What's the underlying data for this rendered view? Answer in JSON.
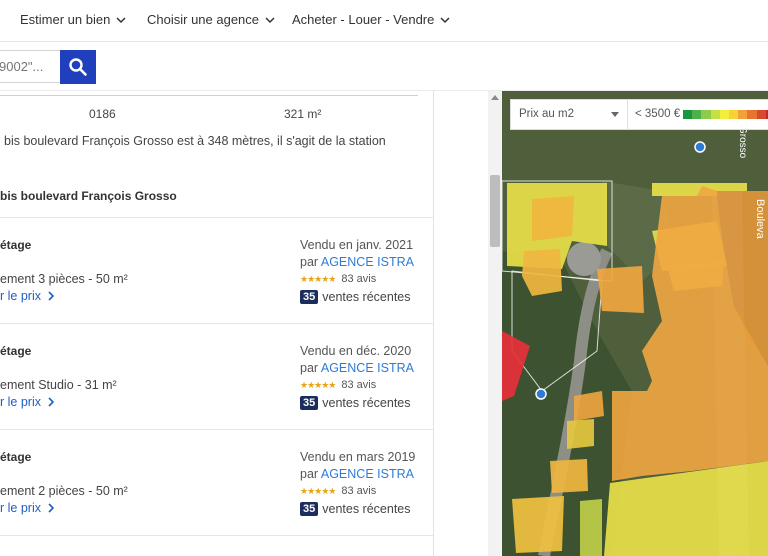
{
  "nav": {
    "items": [
      {
        "label": "Estimer un bien"
      },
      {
        "label": "Choisir une agence"
      },
      {
        "label": "Acheter - Louer - Vendre"
      }
    ]
  },
  "search": {
    "placeholder": "9002\"..."
  },
  "info_row": {
    "ref": "0186",
    "surface": "321 m²"
  },
  "station_text": "bis boulevard François Grosso est à 348 mètres, il s'agit de la station",
  "section_title": "bis boulevard François Grosso",
  "listings": [
    {
      "floor": "étage",
      "desc": "ement 3 pièces - 50 m²",
      "price_link": "r le prix",
      "sold": "Vendu en janv. 2021",
      "agency_prefix": "par",
      "agency": "AGENCE ISTRA",
      "stars": "★★★★★",
      "reviews": "83 avis",
      "recent_count": "35",
      "recent_label": "ventes récentes"
    },
    {
      "floor": "étage",
      "desc": "ement Studio - 31 m²",
      "price_link": "r le prix",
      "sold": "Vendu en déc. 2020",
      "agency_prefix": "par",
      "agency": "AGENCE ISTRA",
      "stars": "★★★★★",
      "reviews": "83 avis",
      "recent_count": "35",
      "recent_label": "ventes récentes"
    },
    {
      "floor": "étage",
      "desc": "ement 2 pièces - 50 m²",
      "price_link": "r le prix",
      "sold": "Vendu en mars 2019",
      "agency_prefix": "par",
      "agency": "AGENCE ISTRA",
      "stars": "★★★★★",
      "reviews": "83 avis",
      "recent_count": "35",
      "recent_label": "ventes récentes"
    }
  ],
  "map": {
    "metric_select": "Prix au m2",
    "legend_label": "< 3500 €",
    "street_label_1": "Bouleva",
    "street_label_2": "Grosso",
    "scale_colors": [
      "#1a9641",
      "#4cb34a",
      "#8ccc4a",
      "#c4e043",
      "#f2ef3c",
      "#f6d13a",
      "#f0a23a",
      "#e8752f",
      "#d94a2b",
      "#c0282a"
    ],
    "colors": {
      "yellow": "#e8e04a",
      "orange": "#f0a640",
      "red": "#e6303a",
      "pin": "#2e7bd6"
    }
  }
}
